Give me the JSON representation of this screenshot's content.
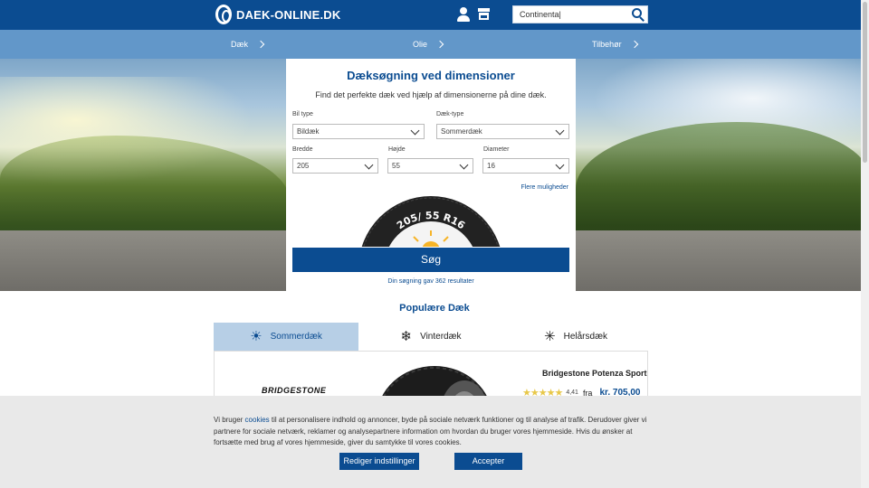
{
  "header": {
    "logo_text": "DAEK-ONLINE.DK",
    "search": {
      "value": "Continenta|"
    }
  },
  "nav": {
    "items": [
      {
        "label": "Dæk"
      },
      {
        "label": "Olie"
      },
      {
        "label": "Tilbehør"
      }
    ]
  },
  "search_panel": {
    "title": "Dæksøgning ved dimensioner",
    "subtitle": "Find det perfekte dæk ved hjælp af dimensionerne på dine dæk.",
    "fields": {
      "car_type": {
        "label": "Bil type",
        "value": "Bildæk"
      },
      "tire_type": {
        "label": "Dæk-type",
        "value": "Sommerdæk"
      },
      "width": {
        "label": "Bredde",
        "value": "205"
      },
      "height": {
        "label": "Højde",
        "value": "55"
      },
      "diameter": {
        "label": "Diameter",
        "value": "16"
      }
    },
    "more_options": "Flere muligheder",
    "tire_size_text": "205/ 55 R16",
    "search_button": "Søg",
    "results_text": "Din søgning gav 362 resultater"
  },
  "popular": {
    "title": "Populære Dæk",
    "tabs": [
      {
        "label": "Sommerdæk",
        "icon": "sun-icon"
      },
      {
        "label": "Vinterdæk",
        "icon": "snowflake-icon"
      },
      {
        "label": "Helårsdæk",
        "icon": "sun-snowflake-icon"
      }
    ],
    "product": {
      "brand": "BRIDGESTONE",
      "name": "Bridgestone Potenza Sport",
      "stars": "★★★★★",
      "rating": "4,41",
      "rating_value": 4.41,
      "from": "fra",
      "price": "kr. 705,00"
    }
  },
  "cookie": {
    "text_before": "Vi bruger ",
    "link": "cookies",
    "text_after": " til at personalisere indhold og annoncer, byde på sociale netværk funktioner og til analyse af trafik. Derudover giver vi partnere for sociale netværk, reklamer og analysepartnere information om hvordan du bruger vores hjemmeside. Hvis du ønsker at fortsætte med brug af vores hjemmeside, giver du samtykke til vores cookies.",
    "settings_button": "Rediger indstillinger",
    "accept_button": "Accepter"
  },
  "colors": {
    "brand_blue": "#0b4c91",
    "nav_blue": "#6297c9",
    "active_tab": "#b7cfe6",
    "star": "#e8c84a"
  }
}
